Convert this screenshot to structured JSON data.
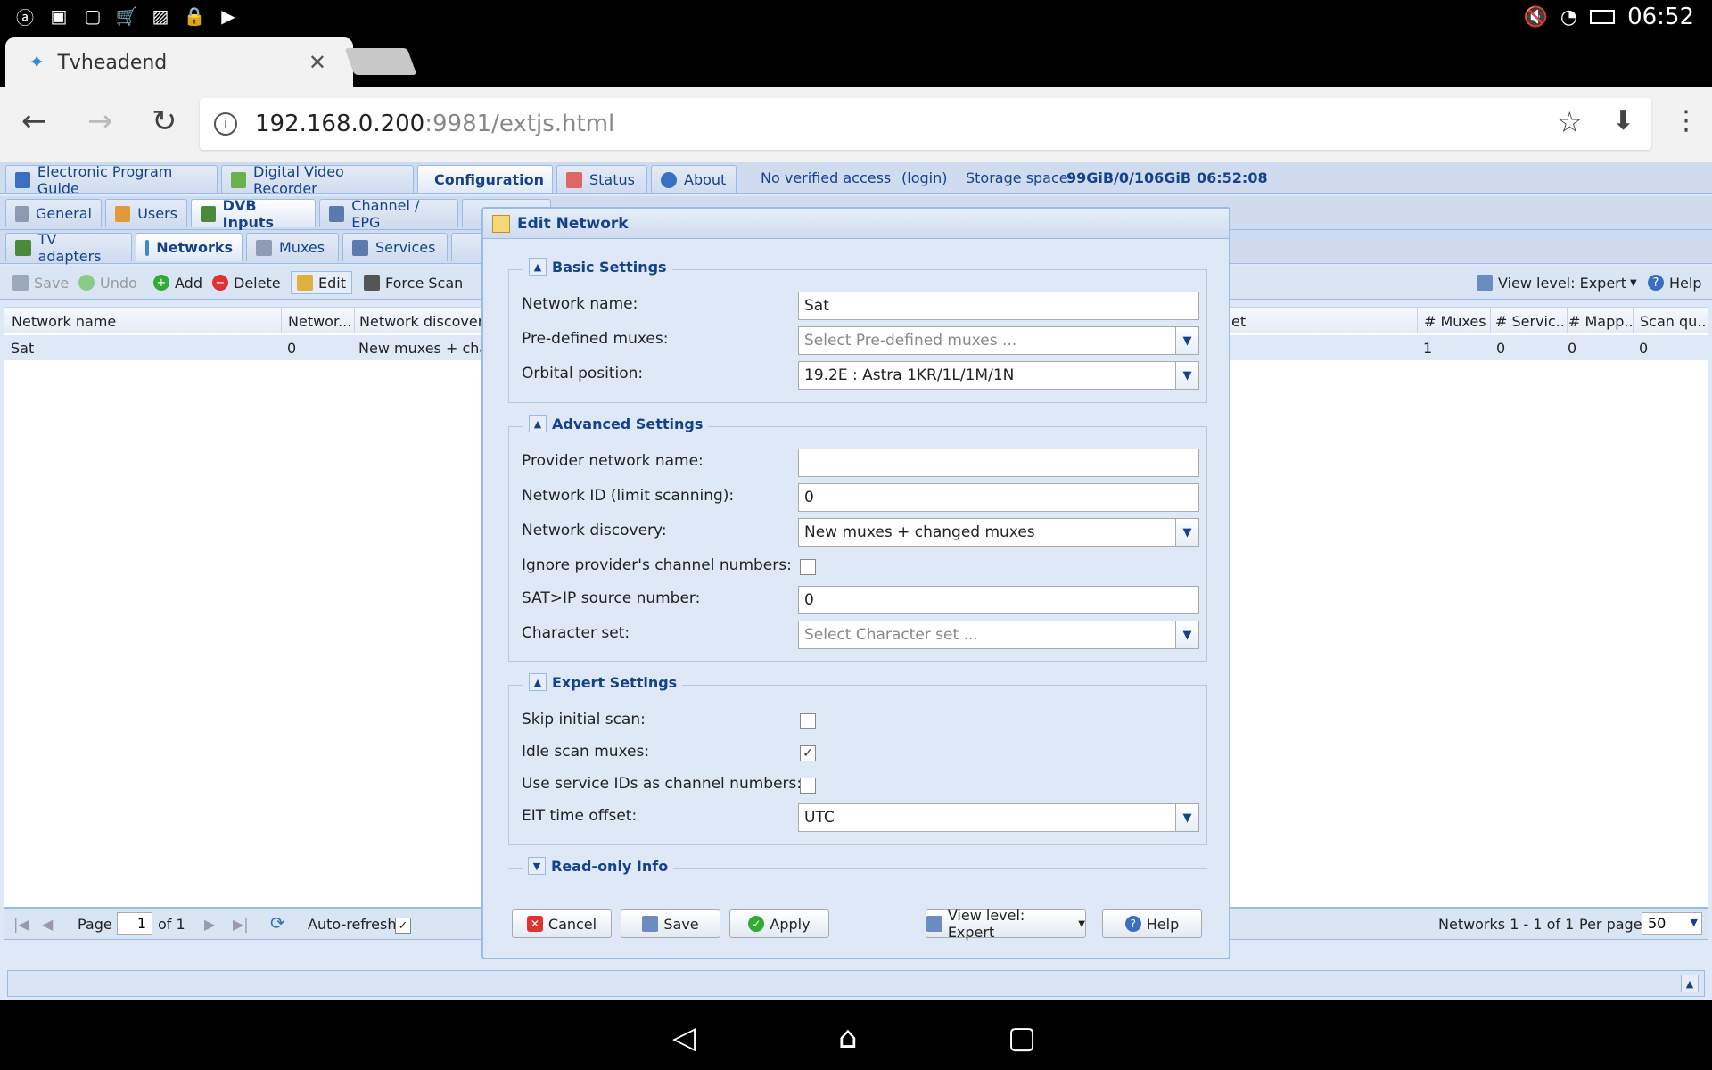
{
  "status": {
    "time": "06:52"
  },
  "browser": {
    "tab_title": "Tvheadend",
    "url_host": "192.168.0.200",
    "url_path": ":9981/extjs.html"
  },
  "topnav": {
    "tabs": [
      "Electronic Program Guide",
      "Digital Video Recorder",
      "Configuration",
      "Status",
      "About"
    ],
    "access": "No verified access",
    "login": "(login)",
    "storage_label": "Storage space:",
    "storage_value": "99GiB/0/106GiB",
    "clock": "06:52:08"
  },
  "subnav": {
    "tabs": [
      "General",
      "Users",
      "DVB Inputs",
      "Channel / EPG"
    ]
  },
  "dvbnav": {
    "tabs": [
      "TV adapters",
      "Networks",
      "Muxes",
      "Services"
    ]
  },
  "gridtool": {
    "save": "Save",
    "undo": "Undo",
    "add": "Add",
    "delete": "Delete",
    "edit": "Edit",
    "force_scan": "Force Scan",
    "view_level": "View level: Expert",
    "help": "Help"
  },
  "grid": {
    "headers": [
      "Network name",
      "Networ...",
      "Network discovery",
      "et",
      "# Muxes",
      "# Servic...",
      "# Mapp...",
      "Scan qu..."
    ],
    "row": {
      "name": "Sat",
      "id": "0",
      "discovery": "New muxes + char",
      "muxes": "1",
      "services": "0",
      "mapped": "0",
      "scan": "0"
    }
  },
  "pager": {
    "page": "Page",
    "page_num": "1",
    "of": "of 1",
    "auto_refresh": "Auto-refresh",
    "summary": "Networks 1 - 1 of 1",
    "per_page": "Per page",
    "per_page_value": "50"
  },
  "dialog": {
    "title": "Edit Network",
    "basic": {
      "legend": "Basic Settings",
      "network_name_label": "Network name:",
      "network_name": "Sat",
      "predefined_label": "Pre-defined muxes:",
      "predefined_placeholder": "Select Pre-defined muxes ...",
      "orbital_label": "Orbital position:",
      "orbital": "19.2E : Astra 1KR/1L/1M/1N"
    },
    "advanced": {
      "legend": "Advanced Settings",
      "provider_label": "Provider network name:",
      "provider": "",
      "netid_label": "Network ID (limit scanning):",
      "netid": "0",
      "discovery_label": "Network discovery:",
      "discovery": "New muxes + changed muxes",
      "ignore_label": "Ignore provider's channel numbers:",
      "satip_label": "SAT>IP source number:",
      "satip": "0",
      "charset_label": "Character set:",
      "charset_placeholder": "Select Character set ..."
    },
    "expert": {
      "legend": "Expert Settings",
      "skip_label": "Skip initial scan:",
      "idle_label": "Idle scan muxes:",
      "sid_label": "Use service IDs as channel numbers:",
      "eit_label": "EIT time offset:",
      "eit": "UTC"
    },
    "readonly": {
      "legend": "Read-only Info"
    },
    "buttons": {
      "cancel": "Cancel",
      "save": "Save",
      "apply": "Apply",
      "view_level": "View level: Expert",
      "help": "Help"
    }
  }
}
